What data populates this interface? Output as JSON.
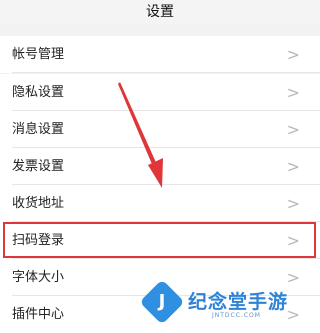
{
  "header": {
    "title": "设置"
  },
  "settings": {
    "items": [
      {
        "label": "帐号管理",
        "chevron": ">"
      },
      {
        "label": "隐私设置",
        "chevron": ">"
      },
      {
        "label": "消息设置",
        "chevron": ">"
      },
      {
        "label": "发票设置",
        "chevron": ">"
      },
      {
        "label": "收货地址",
        "chevron": ">"
      },
      {
        "label": "扫码登录",
        "chevron": ">"
      },
      {
        "label": "字体大小",
        "chevron": ">"
      },
      {
        "label": "插件中心",
        "chevron": ">"
      }
    ],
    "highlighted_item": "扫码登录"
  },
  "annotation": {
    "color": "#e0363a"
  },
  "watermark": {
    "title": "纪念堂手游",
    "domain": "JNTDCC.COM",
    "logo_letter": "J",
    "color": "#2e83d8"
  }
}
